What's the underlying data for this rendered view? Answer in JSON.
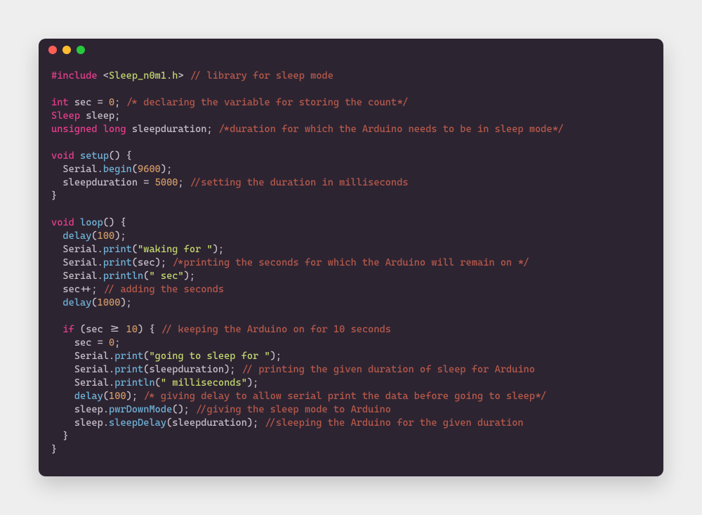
{
  "window": {
    "traffic_lights": [
      "close",
      "minimize",
      "maximize"
    ]
  },
  "code": {
    "lines": [
      [
        {
          "cls": "inc",
          "t": "#include"
        },
        {
          "cls": "pun",
          "t": " <"
        },
        {
          "cls": "hdr",
          "t": "Sleep_n0m1.h"
        },
        {
          "cls": "pun",
          "t": "> "
        },
        {
          "cls": "com",
          "t": "// library for sleep mode"
        }
      ],
      [],
      [
        {
          "cls": "ty",
          "t": "int"
        },
        {
          "cls": "id",
          "t": " sec "
        },
        {
          "cls": "pun",
          "t": "= "
        },
        {
          "cls": "num",
          "t": "0"
        },
        {
          "cls": "pun",
          "t": "; "
        },
        {
          "cls": "com",
          "t": "/* declaring the variable for storing the count*/"
        }
      ],
      [
        {
          "cls": "ty",
          "t": "Sleep"
        },
        {
          "cls": "id",
          "t": " sleep"
        },
        {
          "cls": "pun",
          "t": ";"
        }
      ],
      [
        {
          "cls": "ty",
          "t": "unsigned long"
        },
        {
          "cls": "id",
          "t": " sleepduration"
        },
        {
          "cls": "pun",
          "t": "; "
        },
        {
          "cls": "com",
          "t": "/*duration for which the Arduino needs to be in sleep mode*/"
        }
      ],
      [],
      [
        {
          "cls": "ty",
          "t": "void"
        },
        {
          "cls": "pun",
          "t": " "
        },
        {
          "cls": "fn",
          "t": "setup"
        },
        {
          "cls": "pun",
          "t": "() {"
        }
      ],
      [
        {
          "cls": "pun",
          "t": "  Serial."
        },
        {
          "cls": "fn",
          "t": "begin"
        },
        {
          "cls": "pun",
          "t": "("
        },
        {
          "cls": "num",
          "t": "9600"
        },
        {
          "cls": "pun",
          "t": ");"
        }
      ],
      [
        {
          "cls": "id",
          "t": "  sleepduration "
        },
        {
          "cls": "pun",
          "t": "= "
        },
        {
          "cls": "num",
          "t": "5000"
        },
        {
          "cls": "pun",
          "t": "; "
        },
        {
          "cls": "com",
          "t": "//setting the duration in milliseconds"
        }
      ],
      [
        {
          "cls": "pun",
          "t": "}"
        }
      ],
      [],
      [
        {
          "cls": "ty",
          "t": "void"
        },
        {
          "cls": "pun",
          "t": " "
        },
        {
          "cls": "fn",
          "t": "loop"
        },
        {
          "cls": "pun",
          "t": "() {"
        }
      ],
      [
        {
          "cls": "pun",
          "t": "  "
        },
        {
          "cls": "fn",
          "t": "delay"
        },
        {
          "cls": "pun",
          "t": "("
        },
        {
          "cls": "num",
          "t": "100"
        },
        {
          "cls": "pun",
          "t": ");"
        }
      ],
      [
        {
          "cls": "pun",
          "t": "  Serial."
        },
        {
          "cls": "fn",
          "t": "print"
        },
        {
          "cls": "pun",
          "t": "("
        },
        {
          "cls": "str",
          "t": "\"waking for \""
        },
        {
          "cls": "pun",
          "t": ");"
        }
      ],
      [
        {
          "cls": "pun",
          "t": "  Serial."
        },
        {
          "cls": "fn",
          "t": "print"
        },
        {
          "cls": "pun",
          "t": "(sec); "
        },
        {
          "cls": "com",
          "t": "/*printing the seconds for which the Arduino will remain on */"
        }
      ],
      [
        {
          "cls": "pun",
          "t": "  Serial."
        },
        {
          "cls": "fn",
          "t": "println"
        },
        {
          "cls": "pun",
          "t": "("
        },
        {
          "cls": "str",
          "t": "\" sec\""
        },
        {
          "cls": "pun",
          "t": ");"
        }
      ],
      [
        {
          "cls": "id",
          "t": "  sec"
        },
        {
          "cls": "pun",
          "t": "++; "
        },
        {
          "cls": "com",
          "t": "// adding the seconds"
        }
      ],
      [
        {
          "cls": "pun",
          "t": "  "
        },
        {
          "cls": "fn",
          "t": "delay"
        },
        {
          "cls": "pun",
          "t": "("
        },
        {
          "cls": "num",
          "t": "1000"
        },
        {
          "cls": "pun",
          "t": ");"
        }
      ],
      [],
      [
        {
          "cls": "pun",
          "t": "  "
        },
        {
          "cls": "kw",
          "t": "if"
        },
        {
          "cls": "pun",
          "t": " (sec >= "
        },
        {
          "cls": "num",
          "t": "10"
        },
        {
          "cls": "pun",
          "t": ") { "
        },
        {
          "cls": "com",
          "t": "// keeping the Arduino on for 10 seconds"
        }
      ],
      [
        {
          "cls": "id",
          "t": "    sec "
        },
        {
          "cls": "pun",
          "t": "= "
        },
        {
          "cls": "num",
          "t": "0"
        },
        {
          "cls": "pun",
          "t": ";"
        }
      ],
      [
        {
          "cls": "pun",
          "t": "    Serial."
        },
        {
          "cls": "fn",
          "t": "print"
        },
        {
          "cls": "pun",
          "t": "("
        },
        {
          "cls": "str",
          "t": "\"going to sleep for \""
        },
        {
          "cls": "pun",
          "t": ");"
        }
      ],
      [
        {
          "cls": "pun",
          "t": "    Serial."
        },
        {
          "cls": "fn",
          "t": "print"
        },
        {
          "cls": "pun",
          "t": "(sleepduration); "
        },
        {
          "cls": "com",
          "t": "// printing the given duration of sleep for Arduino"
        }
      ],
      [
        {
          "cls": "pun",
          "t": "    Serial."
        },
        {
          "cls": "fn",
          "t": "println"
        },
        {
          "cls": "pun",
          "t": "("
        },
        {
          "cls": "str",
          "t": "\" milliseconds\""
        },
        {
          "cls": "pun",
          "t": ");"
        }
      ],
      [
        {
          "cls": "pun",
          "t": "    "
        },
        {
          "cls": "fn",
          "t": "delay"
        },
        {
          "cls": "pun",
          "t": "("
        },
        {
          "cls": "num",
          "t": "100"
        },
        {
          "cls": "pun",
          "t": "); "
        },
        {
          "cls": "com",
          "t": "/* giving delay to allow serial print the data before going to sleep*/"
        }
      ],
      [
        {
          "cls": "pun",
          "t": "    sleep."
        },
        {
          "cls": "fn",
          "t": "pwrDownMode"
        },
        {
          "cls": "pun",
          "t": "(); "
        },
        {
          "cls": "com",
          "t": "//giving the sleep mode to Arduino"
        }
      ],
      [
        {
          "cls": "pun",
          "t": "    sleep."
        },
        {
          "cls": "fn",
          "t": "sleepDelay"
        },
        {
          "cls": "pun",
          "t": "(sleepduration); "
        },
        {
          "cls": "com",
          "t": "//sleeping the Arduino for the given duration"
        }
      ],
      [
        {
          "cls": "pun",
          "t": "  }"
        }
      ],
      [
        {
          "cls": "pun",
          "t": "}"
        }
      ]
    ]
  }
}
